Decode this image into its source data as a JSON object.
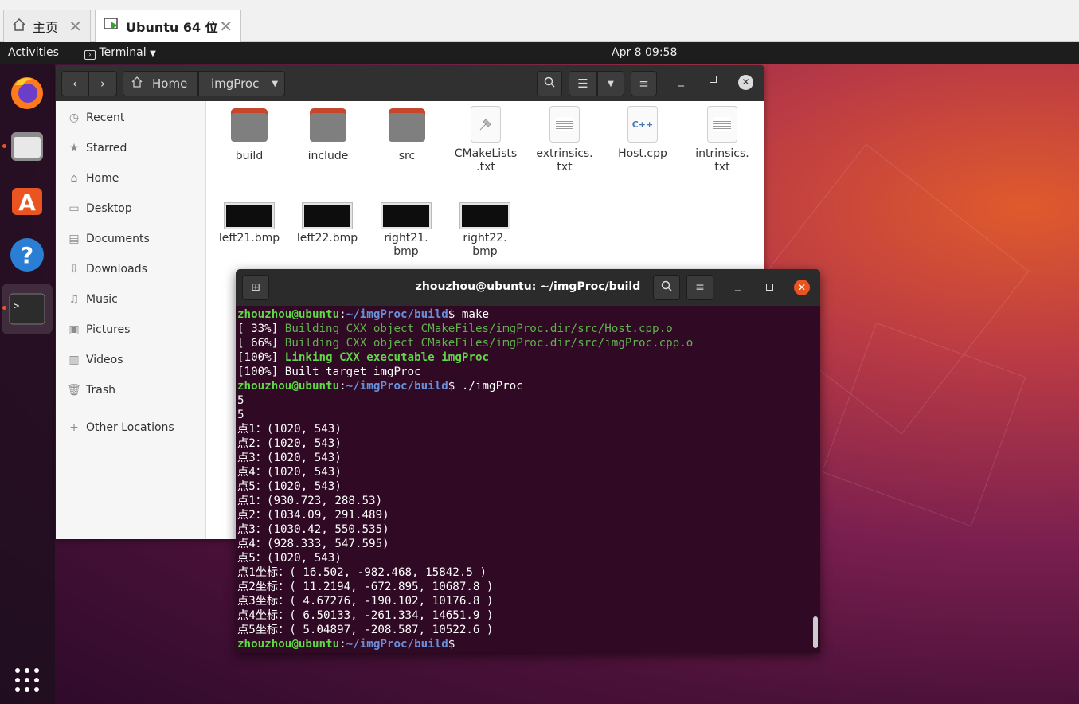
{
  "host_tabs": [
    {
      "label": "主页",
      "icon": "home-icon"
    },
    {
      "label": "Ubuntu 64 位",
      "icon": "vm-icon",
      "active": true
    }
  ],
  "topbar": {
    "activities": "Activities",
    "app_menu": "Terminal",
    "clock": "Apr 8  09:58"
  },
  "dock": {
    "apps": [
      "Firefox",
      "Files",
      "Ubuntu Software",
      "Help",
      "Terminal"
    ],
    "show_apps_icon": "grid-icon"
  },
  "files": {
    "path": {
      "home": "Home",
      "current": "imgProc"
    },
    "sidebar": [
      {
        "label": "Recent",
        "icon": "clock-icon"
      },
      {
        "label": "Starred",
        "icon": "star-icon"
      },
      {
        "label": "Home",
        "icon": "home-icon"
      },
      {
        "label": "Desktop",
        "icon": "desktop-icon"
      },
      {
        "label": "Documents",
        "icon": "document-icon"
      },
      {
        "label": "Downloads",
        "icon": "download-icon"
      },
      {
        "label": "Music",
        "icon": "music-icon"
      },
      {
        "label": "Pictures",
        "icon": "picture-icon"
      },
      {
        "label": "Videos",
        "icon": "video-icon"
      },
      {
        "label": "Trash",
        "icon": "trash-icon"
      },
      {
        "label": "Other Locations",
        "icon": "plus-icon"
      }
    ],
    "items": [
      {
        "name": "build",
        "kind": "folder"
      },
      {
        "name": "include",
        "kind": "folder"
      },
      {
        "name": "src",
        "kind": "folder"
      },
      {
        "name": "CMakeLists\n.txt",
        "kind": "cmake"
      },
      {
        "name": "extrinsics.\ntxt",
        "kind": "text"
      },
      {
        "name": "Host.cpp",
        "kind": "cpp"
      },
      {
        "name": "intrinsics.\ntxt",
        "kind": "text"
      },
      {
        "name": "left21.bmp",
        "kind": "image"
      },
      {
        "name": "left22.bmp",
        "kind": "image"
      },
      {
        "name": "right21.\nbmp",
        "kind": "image"
      },
      {
        "name": "right22.\nbmp",
        "kind": "image"
      }
    ],
    "cpp_badge": "C++"
  },
  "terminal": {
    "title": "zhouzhou@ubuntu: ~/imgProc/build",
    "prompt_user": "zhouzhou@ubuntu",
    "prompt_sep": ":",
    "prompt_path": "~/imgProc/build",
    "lines": [
      {
        "t": "prompt",
        "cmd": "$ make"
      },
      {
        "t": "build",
        "pre": "[ 33%] ",
        "msg": "Building CXX object CMakeFiles/imgProc.dir/src/Host.cpp.o"
      },
      {
        "t": "build",
        "pre": "[ 66%] ",
        "msg": "Building CXX object CMakeFiles/imgProc.dir/src/imgProc.cpp.o"
      },
      {
        "t": "link",
        "pre": "[100%] ",
        "msg": "Linking CXX executable imgProc"
      },
      {
        "t": "out",
        "text": "[100%] Built target imgProc"
      },
      {
        "t": "prompt",
        "cmd": "$ ./imgProc"
      },
      {
        "t": "out",
        "text": "5"
      },
      {
        "t": "out",
        "text": "5"
      },
      {
        "t": "out",
        "text": "点1：(1020, 543)"
      },
      {
        "t": "out",
        "text": "点2：(1020, 543)"
      },
      {
        "t": "out",
        "text": "点3：(1020, 543)"
      },
      {
        "t": "out",
        "text": "点4：(1020, 543)"
      },
      {
        "t": "out",
        "text": "点5：(1020, 543)"
      },
      {
        "t": "out",
        "text": "点1：(930.723, 288.53)"
      },
      {
        "t": "out",
        "text": "点2：(1034.09, 291.489)"
      },
      {
        "t": "out",
        "text": "点3：(1030.42, 550.535)"
      },
      {
        "t": "out",
        "text": "点4：(928.333, 547.595)"
      },
      {
        "t": "out",
        "text": "点5：(1020, 543)"
      },
      {
        "t": "out",
        "text": "点1坐标：( 16.502, -982.468, 15842.5 )"
      },
      {
        "t": "out",
        "text": "点2坐标：( 11.2194, -672.895, 10687.8 )"
      },
      {
        "t": "out",
        "text": "点3坐标：( 4.67276, -190.102, 10176.8 )"
      },
      {
        "t": "out",
        "text": "点4坐标：( 6.50133, -261.334, 14651.9 )"
      },
      {
        "t": "out",
        "text": "点5坐标：( 5.04897, -208.587, 10522.6 )"
      },
      {
        "t": "prompt",
        "cmd": "$ "
      }
    ]
  },
  "colors": {
    "accent": "#e95420",
    "terminal_bg": "#300a24",
    "prompt_green": "#5fd746",
    "prompt_blue": "#6a8fd8"
  }
}
